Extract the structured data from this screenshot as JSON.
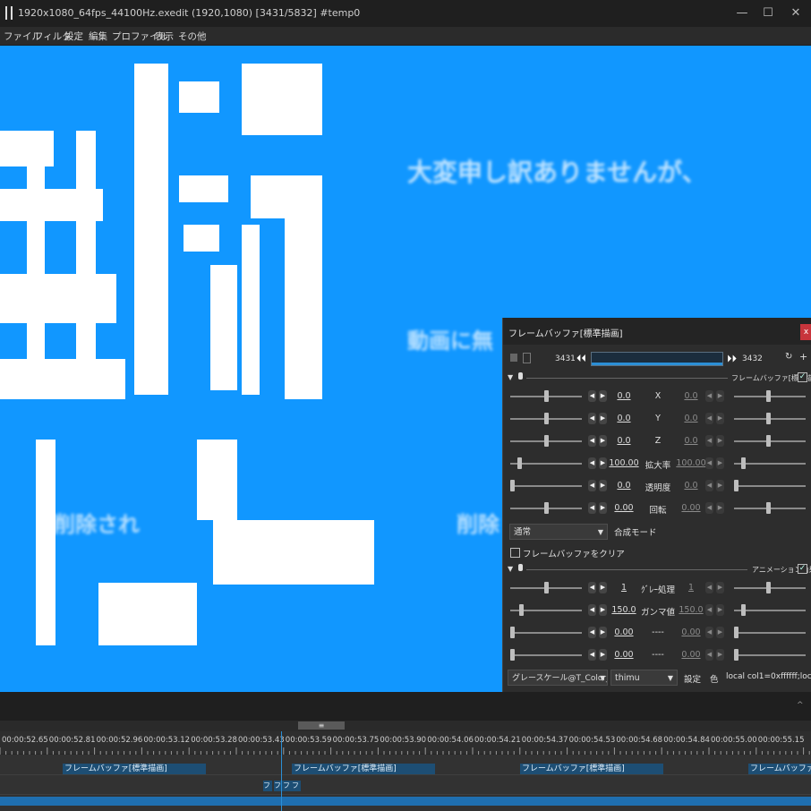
{
  "window": {
    "title": "1920x1080_64fps_44100Hz.exedit (1920,1080)  [3431/5832]  #temp0",
    "minimize": "—",
    "maximize": "☐",
    "close": "✕"
  },
  "menu": [
    "ファイル",
    "フィルタ",
    "設定",
    "編集",
    "プロファイル",
    "表示",
    "その他"
  ],
  "preview": {
    "big_chars": [
      "無断",
      "ブ",
      "ー"
    ],
    "sub_texts": [
      "大変申し訳ありませんが、",
      "動画に無",
      "削除され",
      "削除"
    ]
  },
  "panel": {
    "title": "フレームバッファ[標準描画]",
    "close": "x",
    "frame_start": "3431",
    "frame_end": "3432",
    "filter1_name": "フレームバッファ[標準描画]",
    "rows1": [
      {
        "left": "0.0",
        "label": "X",
        "right": "0.0"
      },
      {
        "left": "0.0",
        "label": "Y",
        "right": "0.0"
      },
      {
        "left": "0.0",
        "label": "Z",
        "right": "0.0"
      },
      {
        "left": "100.00",
        "label": "拡大率",
        "right": "100.00"
      },
      {
        "left": "0.0",
        "label": "透明度",
        "right": "0.0"
      },
      {
        "left": "0.00",
        "label": "回転",
        "right": "0.00"
      }
    ],
    "blend_mode": "通常",
    "blend_label": "合成モード",
    "clear_label": "フレームバッファをクリア",
    "filter2_name": "アニメーション効果",
    "rows2": [
      {
        "left": "1",
        "label": "ｸﾞﾚｰ処理",
        "right": "1"
      },
      {
        "left": "150.0",
        "label": "ガンマ値",
        "right": "150.0"
      },
      {
        "left": "0.00",
        "label": "----",
        "right": "0.00"
      },
      {
        "left": "0.00",
        "label": "----",
        "right": "0.00"
      }
    ],
    "script_select": "グレースケール@T_Color_Mc",
    "author_select": "thimu",
    "settings_label": "設定",
    "color_label": "色",
    "params_text": "local col1=0xffffff;local co"
  },
  "timeline": {
    "times": [
      "00:00:52.65",
      "00:00:52.81",
      "00:00:52.96",
      "00:00:53.12",
      "00:00:53.28",
      "00:00:53.43",
      "00:00:53.59",
      "00:00:53.75",
      "00:00:53.90",
      "00:00:54.06",
      "00:00:54.21",
      "00:00:54.37",
      "00:00:54.53",
      "00:00:54.68",
      "00:00:54.84",
      "00:00:55.00",
      "00:00:55.15"
    ],
    "clip_label": "フレームバッファ[標準描画]",
    "small_clips": [
      "フ",
      "フ",
      "フ",
      "フ"
    ],
    "scroll_handle": "≡"
  },
  "colors": {
    "preview_bg": "#1197ff",
    "clip": "#1d4e74",
    "accent_playhead": "#2b8fd6"
  }
}
